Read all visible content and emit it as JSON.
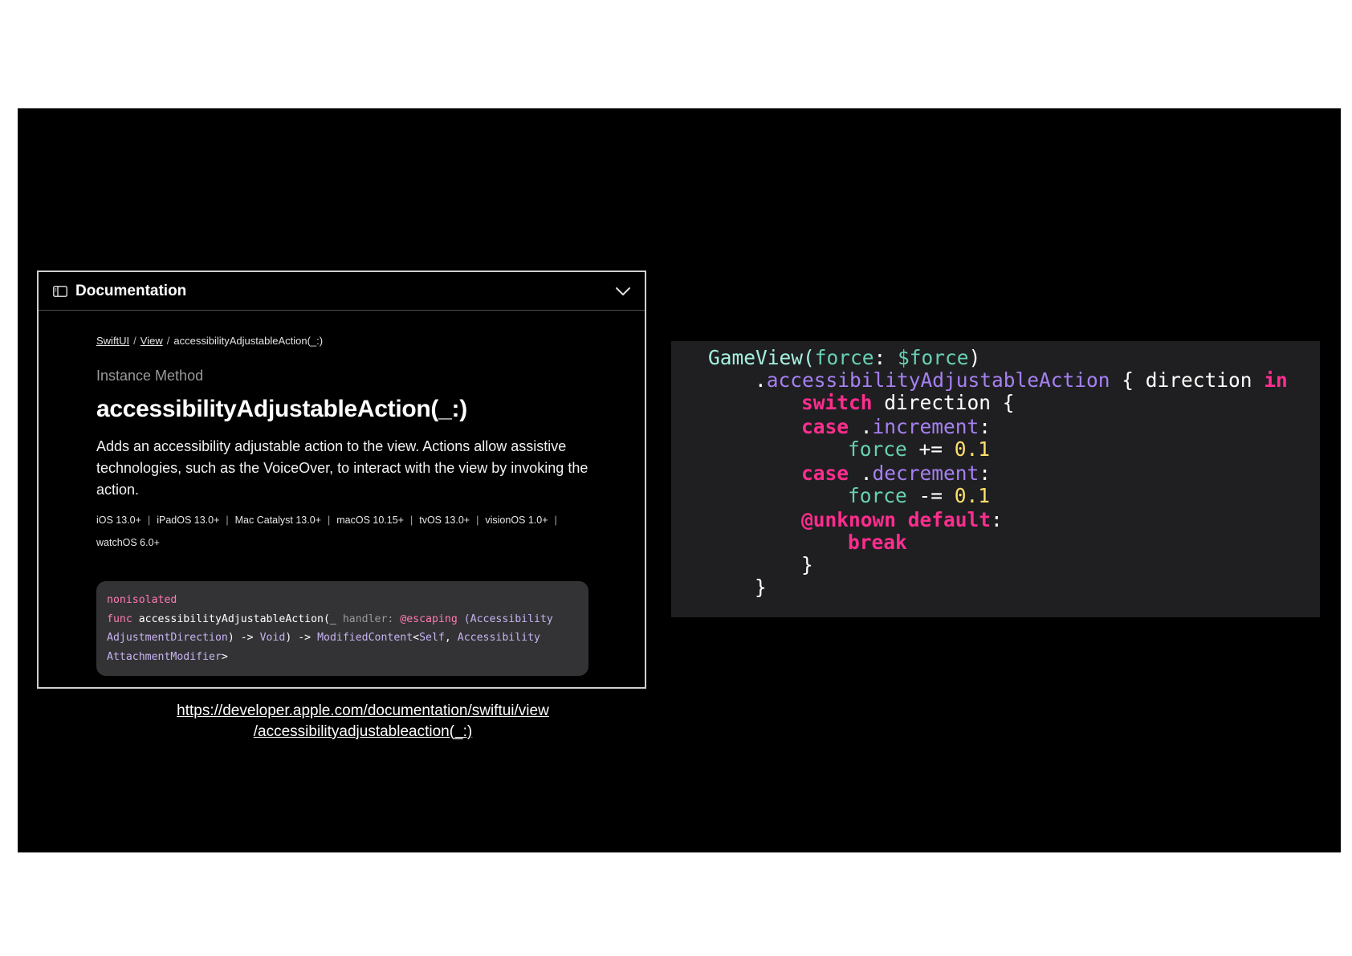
{
  "doc": {
    "header_title": "Documentation",
    "breadcrumb": [
      "SwiftUI",
      "View",
      "accessibilityAdjustableAction(_:)"
    ],
    "breadcrumb_sep": "/",
    "kind": "Instance Method",
    "method_title": "accessibilityAdjustableAction(_:)",
    "description": "Adds an accessibility adjustable action to the view. Actions allow assistive technologies, such as the VoiceOver, to interact with the view by invoking the action.",
    "platforms": [
      "iOS 13.0+",
      "iPadOS 13.0+",
      "Mac Catalyst 13.0+",
      "macOS 10.15+",
      "tvOS 13.0+",
      "visionOS 1.0+",
      "watchOS 6.0+"
    ],
    "declaration": {
      "attr": "nonisolated",
      "func_kw": "func",
      "name": "accessibilityAdjustableAction(_",
      "param": "handler:",
      "escaping": "@escaping",
      "type1": "(Accessibility",
      "type1b": "AdjustmentDirection",
      "arrow1": ") ->",
      "void": "Void",
      "arrow2": ") ->",
      "ret": "ModifiedContent",
      "lt": "<",
      "self": "Self",
      "comma": ",",
      "ret2": "Accessibility",
      "ret2b": "AttachmentModifier",
      "gt": ">"
    }
  },
  "url": {
    "line1": "https://developer.apple.com/documentation/swiftui/view",
    "line2": "/accessibilityadjustableaction(_:)"
  },
  "code": {
    "l1": {
      "a": "GameView(",
      "b": "force",
      "c": ": ",
      "d": "$force",
      "e": ")"
    },
    "l2": {
      "a": ".",
      "b": "accessibilityAdjustableAction",
      "c": " { direction ",
      "d": "in"
    },
    "l3": {
      "a": "switch",
      "b": " direction {"
    },
    "l4": {
      "a": "case",
      "b": " .",
      "c": "increment",
      "d": ":"
    },
    "l5": {
      "a": "force",
      "b": " += ",
      "c": "0.1"
    },
    "l6": {
      "a": "case",
      "b": " .",
      "c": "decrement",
      "d": ":"
    },
    "l7": {
      "a": "force",
      "b": " -= ",
      "c": "0.1"
    },
    "l8": {
      "a": "@unknown default",
      "b": ":"
    },
    "l9": {
      "a": "break"
    },
    "l10": {
      "a": "}"
    },
    "l11": {
      "a": "}"
    }
  }
}
